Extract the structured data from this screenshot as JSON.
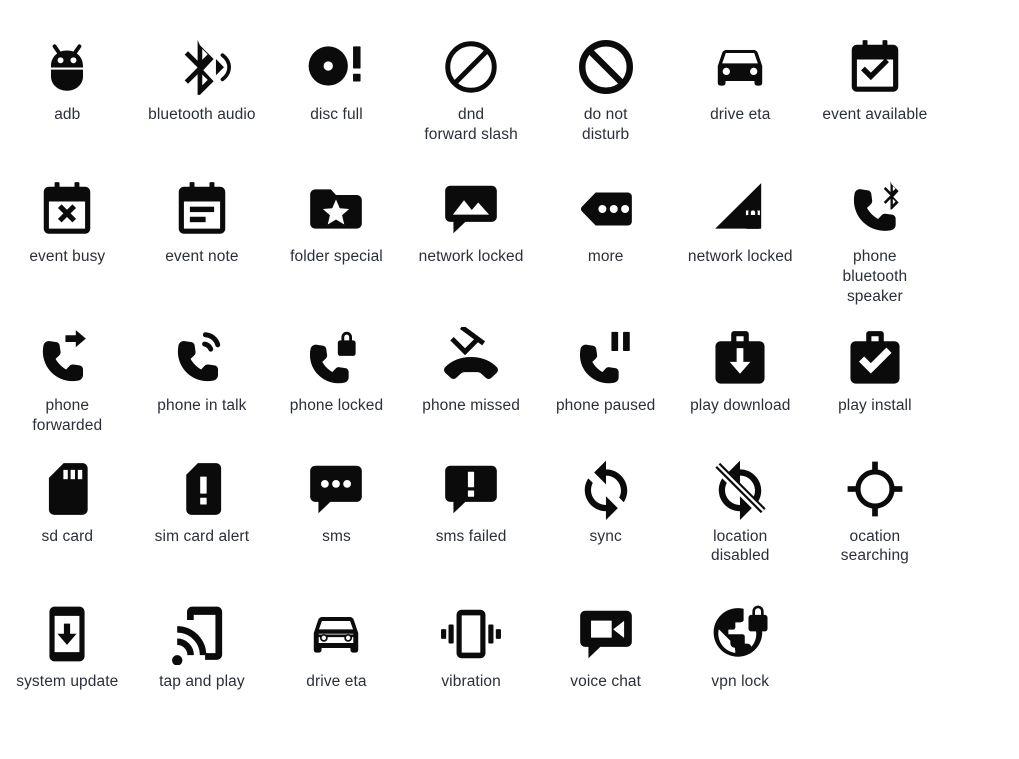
{
  "page": {
    "title": "Android status / notification icon sheet",
    "background_color": "#ffffff",
    "icon_color": "#0b0b0b",
    "label_color": "#2b2f38",
    "columns": 7,
    "rows": 5,
    "total_icons": 34
  },
  "rows": [
    {
      "index": 0,
      "cells": [
        {
          "label": "adb",
          "icon": "adb-bug-icon"
        },
        {
          "label": "bluetooth audio",
          "icon": "bluetooth-audio-icon"
        },
        {
          "label": "disc full",
          "icon": "disc-full-icon"
        },
        {
          "label": "dnd\nforward slash",
          "icon": "dnd-forward-slash-icon"
        },
        {
          "label": "do not\ndisturb",
          "icon": "do-not-disturb-icon"
        },
        {
          "label": "drive eta",
          "icon": "drive-eta-filled-icon"
        },
        {
          "label": "event available",
          "icon": "event-available-icon"
        }
      ]
    },
    {
      "index": 1,
      "cells": [
        {
          "label": "event busy",
          "icon": "event-busy-icon"
        },
        {
          "label": "event note",
          "icon": "event-note-icon"
        },
        {
          "label": "folder special",
          "icon": "folder-special-icon"
        },
        {
          "label": "network locked",
          "icon": "image-message-icon"
        },
        {
          "label": "more",
          "icon": "more-icon"
        },
        {
          "label": "network locked",
          "icon": "network-locked-signal-icon"
        },
        {
          "label": "phone\nbluetooth\nspeaker",
          "icon": "phone-bluetooth-speaker-icon"
        }
      ]
    },
    {
      "index": 2,
      "cells": [
        {
          "label": "phone\nforwarded",
          "icon": "phone-forwarded-icon"
        },
        {
          "label": "phone in talk",
          "icon": "phone-in-talk-icon"
        },
        {
          "label": "phone locked",
          "icon": "phone-locked-icon"
        },
        {
          "label": "phone missed",
          "icon": "phone-missed-icon"
        },
        {
          "label": "phone paused",
          "icon": "phone-paused-icon"
        },
        {
          "label": "play download",
          "icon": "play-download-icon"
        },
        {
          "label": "play install",
          "icon": "play-install-icon"
        }
      ]
    },
    {
      "index": 3,
      "cells": [
        {
          "label": "sd card",
          "icon": "sd-card-icon"
        },
        {
          "label": "sim card alert",
          "icon": "sim-card-alert-icon"
        },
        {
          "label": "sms",
          "icon": "sms-icon"
        },
        {
          "label": "sms failed",
          "icon": "sms-failed-icon"
        },
        {
          "label": "sync",
          "icon": "sync-icon"
        },
        {
          "label": "location\ndisabled",
          "icon": "location-disabled-icon"
        },
        {
          "label": "ocation\nsearching",
          "icon": "location-searching-icon"
        }
      ]
    },
    {
      "index": 4,
      "cells": [
        {
          "label": "system update",
          "icon": "system-update-icon"
        },
        {
          "label": "tap and play",
          "icon": "tap-and-play-icon"
        },
        {
          "label": "drive eta",
          "icon": "drive-eta-outline-icon"
        },
        {
          "label": "vibration",
          "icon": "vibration-icon"
        },
        {
          "label": "voice chat",
          "icon": "voice-chat-icon"
        },
        {
          "label": "vpn lock",
          "icon": "vpn-lock-icon"
        },
        {
          "label": "",
          "icon": ""
        }
      ]
    }
  ]
}
